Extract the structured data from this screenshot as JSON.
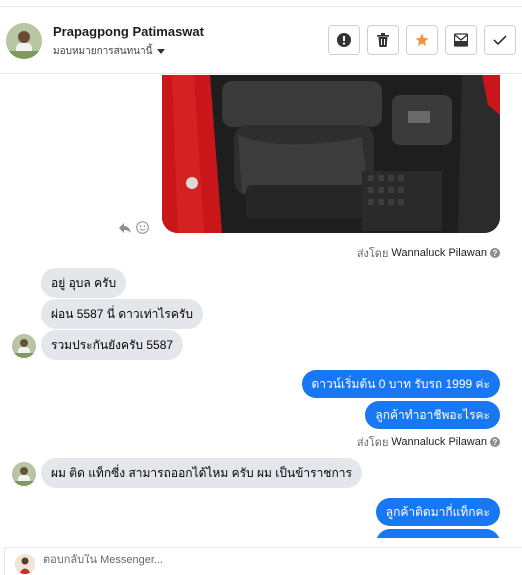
{
  "header": {
    "name": "Prapagpong Patimaswat",
    "assign_label": "มอบหมายการสนทนานี้",
    "tools": [
      {
        "icon": "alert-icon"
      },
      {
        "icon": "trash-icon"
      },
      {
        "icon": "star-icon"
      },
      {
        "icon": "archive-icon"
      },
      {
        "icon": "check-icon"
      }
    ],
    "star_color": "#f7923a"
  },
  "messages": {
    "sent_by_1": {
      "prefix": "ส่งโดย",
      "name": "Wannaluck Pilawan"
    },
    "in_1": "อยู่ อุบล ครับ",
    "in_2": "ผ่อน 5587 นี่ ดาวเท่าไรครับ",
    "in_3": "รวมประกันยังครับ 5587",
    "out_1": "ดาวน์เริ่มต้น 0 บาท รับรถ 1999 ค่ะ",
    "out_2": "ลูกค้าทำอาชีพอะไรคะ",
    "sent_by_2": {
      "prefix": "ส่งโดย",
      "name": "Wannaluck Pilawan"
    },
    "in_4": "ผม ติด แท็กซี่ง สามารถออกได้ไหม ครับ ผม เป็นข้าราชการ",
    "out_3": "ลูกค้าติดมากี่แท็กคะ"
  },
  "reply": {
    "placeholder": "ตอบกลับใน Messenger..."
  },
  "colors": {
    "outgoing": "#1877f2",
    "incoming": "#e4e6eb"
  }
}
